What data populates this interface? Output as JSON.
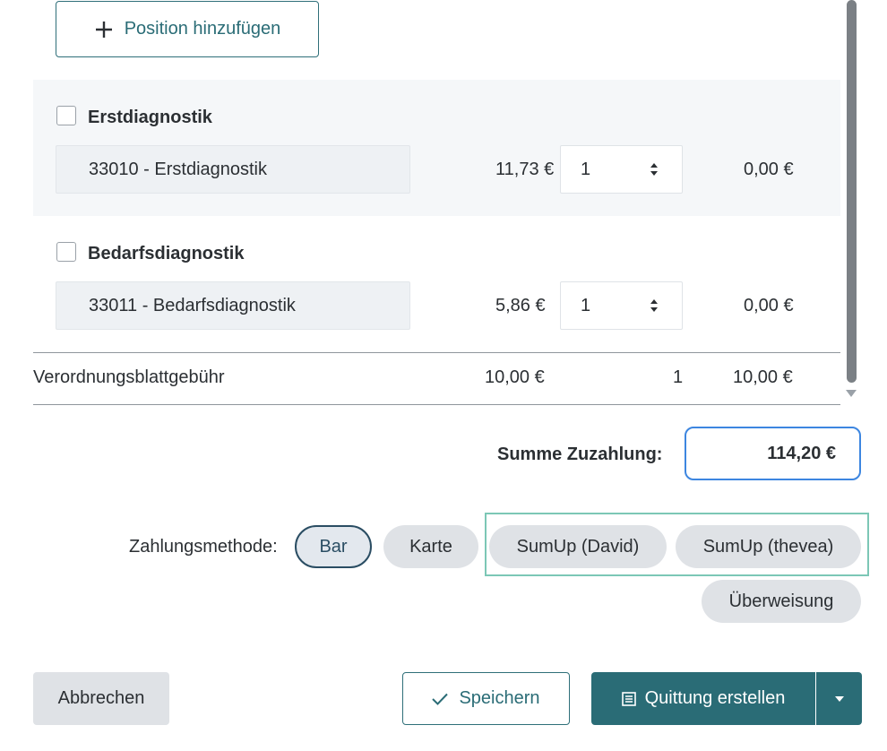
{
  "toolbar": {
    "add_position_label": "Position hinzufügen"
  },
  "items": [
    {
      "title": "Erstdiagnostik",
      "code": "33010 - Erstdiagnostik",
      "price": "11,73 €",
      "qty": "1",
      "total": "0,00 €"
    },
    {
      "title": "Bedarfsdiagnostik",
      "code": "33011 - Bedarfsdiagnostik",
      "price": "5,86 €",
      "qty": "1",
      "total": "0,00 €"
    }
  ],
  "fee": {
    "label": "Verordnungsblattgebühr",
    "price": "10,00 €",
    "qty": "1",
    "total": "10,00 €"
  },
  "summary": {
    "label": "Summe Zuzahlung:",
    "value": "114,20 €"
  },
  "payment": {
    "label": "Zahlungsmethode:",
    "options": [
      "Bar",
      "Karte",
      "SumUp (David)",
      "SumUp (thevea)",
      "Überweisung"
    ],
    "selected": "Bar"
  },
  "footer": {
    "cancel_label": "Abbrechen",
    "save_label": "Speichern",
    "receipt_label": "Quittung erstellen"
  },
  "colors": {
    "primary": "#2a6c76",
    "focus_blue": "#3d86e0",
    "sumup_highlight": "#7cc7b6"
  }
}
